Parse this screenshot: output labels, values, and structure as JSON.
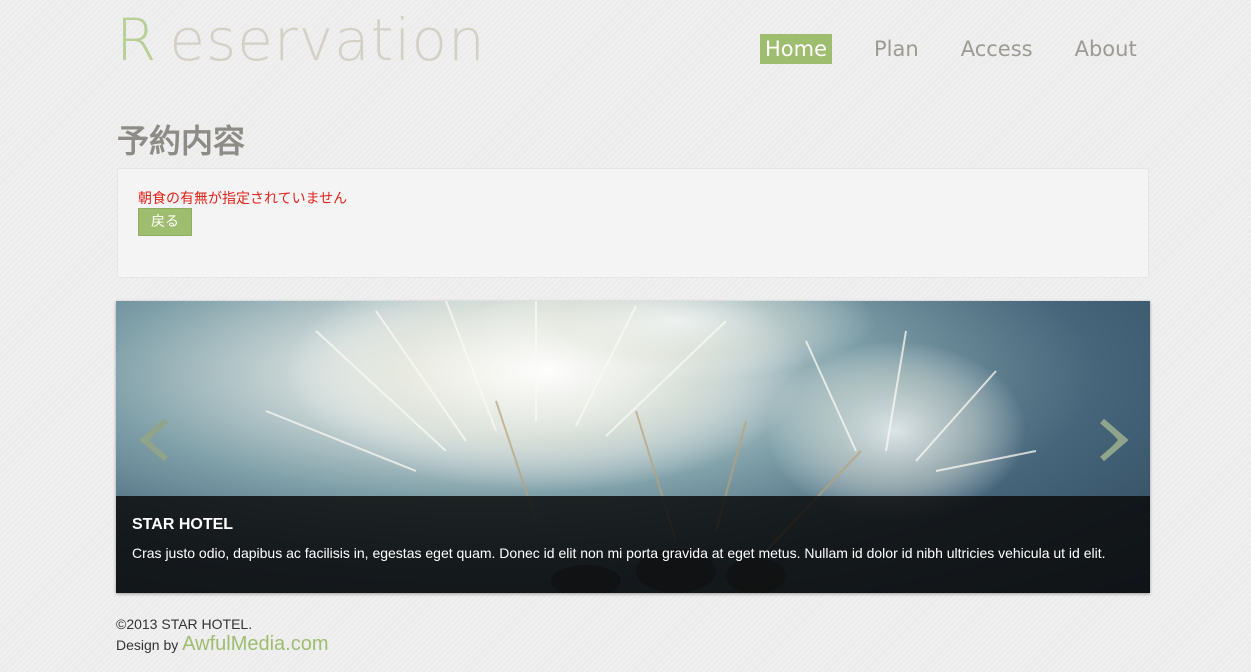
{
  "header": {
    "logo_initial": "R",
    "logo_rest": "eservation",
    "nav": [
      {
        "label": "Home"
      },
      {
        "label": "Plan"
      },
      {
        "label": "Access"
      },
      {
        "label": "About"
      }
    ]
  },
  "main": {
    "title": "予約内容",
    "error_message": "朝食の有無が指定されていません",
    "back_button": "戻る"
  },
  "slider": {
    "caption_title": "STAR HOTEL",
    "caption_text": "Cras justo odio, dapibus ac facilisis in, egestas eget quam. Donec id elit non mi porta gravida at eget metus. Nullam id dolor id nibh ultricies vehicula ut id elit.",
    "prev_icon": "chevron-left-icon",
    "next_icon": "chevron-right-icon"
  },
  "footer": {
    "copyright": "©2013 STAR HOTEL.",
    "design_by": "Design by ",
    "brand": "AwfulMedia.com"
  },
  "colors": {
    "accent": "#9fbd6f",
    "error": "#e2231a",
    "logo": "#d3d0c6"
  }
}
